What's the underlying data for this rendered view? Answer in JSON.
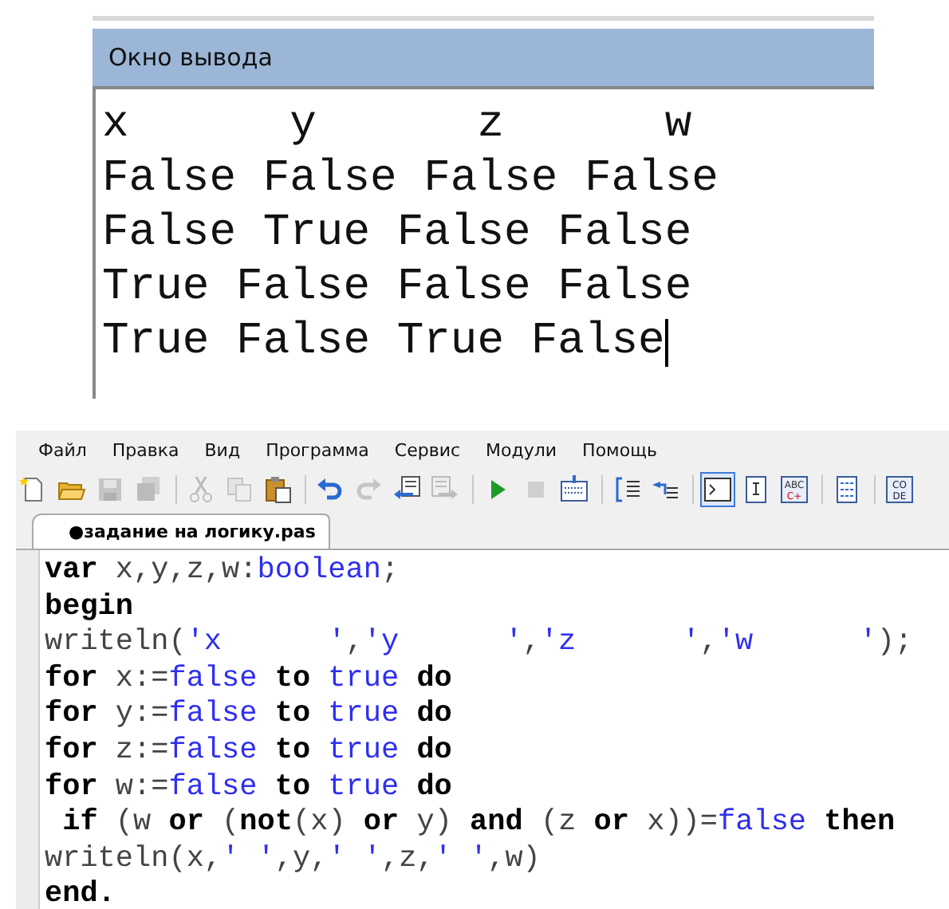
{
  "output_window": {
    "title": "Окно вывода",
    "lines": [
      "x      y      z      w",
      "False False False False",
      "False True False False",
      "True False False False",
      "True False True False"
    ],
    "cursor": true
  },
  "menu": [
    "Файл",
    "Правка",
    "Вид",
    "Программа",
    "Сервис",
    "Модули",
    "Помощь"
  ],
  "toolbar": [
    {
      "kind": "new",
      "disabled": false,
      "pressed": false
    },
    {
      "kind": "open",
      "disabled": false,
      "pressed": false
    },
    {
      "kind": "save",
      "disabled": true,
      "pressed": false
    },
    {
      "kind": "saveall",
      "disabled": true,
      "pressed": false
    },
    {
      "kind": "separator"
    },
    {
      "kind": "cut",
      "disabled": true,
      "pressed": false
    },
    {
      "kind": "copy",
      "disabled": true,
      "pressed": false
    },
    {
      "kind": "paste",
      "disabled": false,
      "pressed": false
    },
    {
      "kind": "separator"
    },
    {
      "kind": "undo",
      "disabled": false,
      "pressed": false
    },
    {
      "kind": "redo",
      "disabled": true,
      "pressed": false
    },
    {
      "kind": "back",
      "disabled": false,
      "pressed": false
    },
    {
      "kind": "forward",
      "disabled": true,
      "pressed": false
    },
    {
      "kind": "separator"
    },
    {
      "kind": "run",
      "disabled": false,
      "pressed": false
    },
    {
      "kind": "stop",
      "disabled": true,
      "pressed": false
    },
    {
      "kind": "compile",
      "disabled": false,
      "pressed": false
    },
    {
      "kind": "separator"
    },
    {
      "kind": "stepin",
      "disabled": false,
      "pressed": false
    },
    {
      "kind": "stepover",
      "disabled": false,
      "pressed": false
    },
    {
      "kind": "separator"
    },
    {
      "kind": "console",
      "disabled": false,
      "pressed": true
    },
    {
      "kind": "form",
      "disabled": false,
      "pressed": false
    },
    {
      "kind": "spell",
      "label": [
        "ABC",
        "C+"
      ],
      "disabled": false,
      "pressed": false
    },
    {
      "kind": "separator"
    },
    {
      "kind": "doc",
      "disabled": false,
      "pressed": false
    },
    {
      "kind": "separator"
    },
    {
      "kind": "code",
      "label": [
        "CO",
        "DE"
      ],
      "disabled": false,
      "pressed": false
    }
  ],
  "tabs": [
    {
      "label": "●задание на логику.pas",
      "selected": true
    }
  ],
  "code": [
    [
      {
        "kind": "keyword",
        "t": "var"
      },
      {
        "kind": "plain",
        "t": " x,y,z,w:"
      },
      {
        "kind": "literal",
        "t": "boolean"
      },
      {
        "kind": "plain",
        "t": ";"
      }
    ],
    [
      {
        "kind": "keyword",
        "t": "begin"
      }
    ],
    [
      {
        "kind": "plain",
        "t": "writeln("
      },
      {
        "kind": "literal",
        "t": "'x      '"
      },
      {
        "kind": "plain",
        "t": ","
      },
      {
        "kind": "literal",
        "t": "'y      '"
      },
      {
        "kind": "plain",
        "t": ","
      },
      {
        "kind": "literal",
        "t": "'z      '"
      },
      {
        "kind": "plain",
        "t": ","
      },
      {
        "kind": "literal",
        "t": "'w      '"
      },
      {
        "kind": "plain",
        "t": ");"
      }
    ],
    [
      {
        "kind": "keyword",
        "t": "for"
      },
      {
        "kind": "plain",
        "t": " x:="
      },
      {
        "kind": "literal",
        "t": "false"
      },
      {
        "kind": "keyword",
        "t": " to "
      },
      {
        "kind": "literal",
        "t": "true"
      },
      {
        "kind": "keyword",
        "t": " do"
      }
    ],
    [
      {
        "kind": "keyword",
        "t": "for"
      },
      {
        "kind": "plain",
        "t": " y:="
      },
      {
        "kind": "literal",
        "t": "false"
      },
      {
        "kind": "keyword",
        "t": " to "
      },
      {
        "kind": "literal",
        "t": "true"
      },
      {
        "kind": "keyword",
        "t": " do"
      }
    ],
    [
      {
        "kind": "keyword",
        "t": "for"
      },
      {
        "kind": "plain",
        "t": " z:="
      },
      {
        "kind": "literal",
        "t": "false"
      },
      {
        "kind": "keyword",
        "t": " to "
      },
      {
        "kind": "literal",
        "t": "true"
      },
      {
        "kind": "keyword",
        "t": " do"
      }
    ],
    [
      {
        "kind": "keyword",
        "t": "for"
      },
      {
        "kind": "plain",
        "t": " w:="
      },
      {
        "kind": "literal",
        "t": "false"
      },
      {
        "kind": "keyword",
        "t": " to "
      },
      {
        "kind": "literal",
        "t": "true"
      },
      {
        "kind": "keyword",
        "t": " do"
      }
    ],
    [
      {
        "kind": "keyword",
        "t": " if"
      },
      {
        "kind": "plain",
        "t": " (w "
      },
      {
        "kind": "keyword",
        "t": "or"
      },
      {
        "kind": "plain",
        "t": " ("
      },
      {
        "kind": "keyword",
        "t": "not"
      },
      {
        "kind": "plain",
        "t": "(x) "
      },
      {
        "kind": "keyword",
        "t": "or"
      },
      {
        "kind": "plain",
        "t": " y) "
      },
      {
        "kind": "keyword",
        "t": "and"
      },
      {
        "kind": "plain",
        "t": " (z "
      },
      {
        "kind": "keyword",
        "t": "or"
      },
      {
        "kind": "plain",
        "t": " x))="
      },
      {
        "kind": "literal",
        "t": "false"
      },
      {
        "kind": "keyword",
        "t": " then"
      }
    ],
    [
      {
        "kind": "plain",
        "t": "writeln(x,"
      },
      {
        "kind": "literal",
        "t": "' '"
      },
      {
        "kind": "plain",
        "t": ",y,"
      },
      {
        "kind": "literal",
        "t": "' '"
      },
      {
        "kind": "plain",
        "t": ",z,"
      },
      {
        "kind": "literal",
        "t": "' '"
      },
      {
        "kind": "plain",
        "t": ",w)"
      }
    ],
    [
      {
        "kind": "keyword",
        "t": "end."
      }
    ]
  ]
}
